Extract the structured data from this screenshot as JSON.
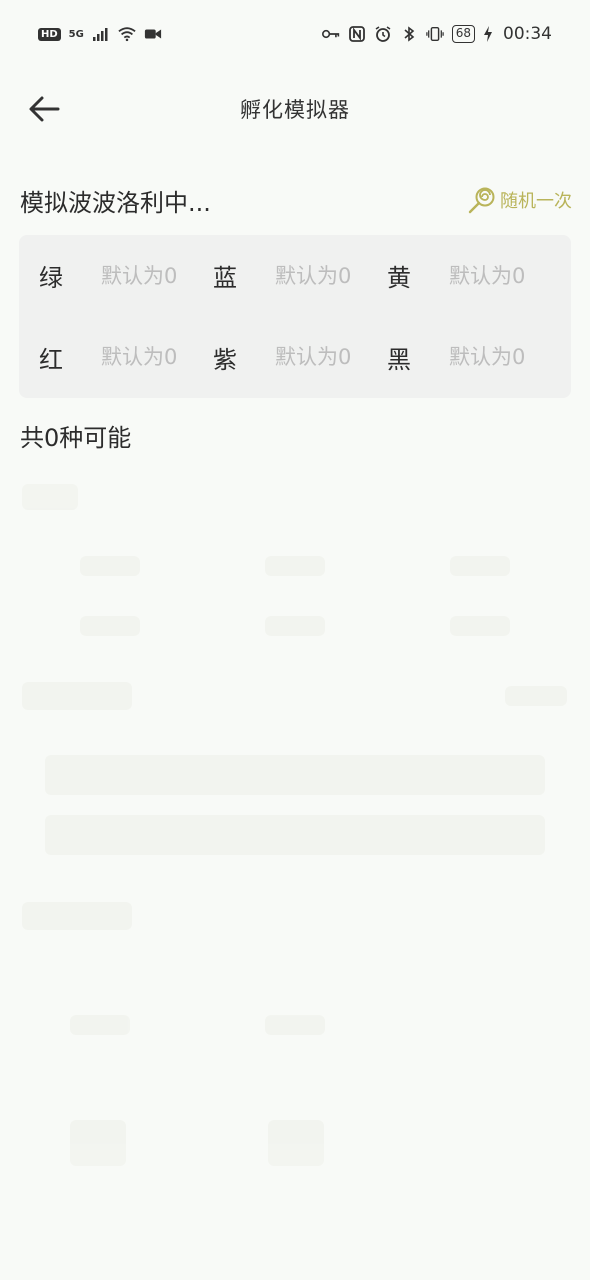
{
  "status_bar": {
    "left_badge": "HD",
    "network": "5G",
    "time": "00:34",
    "battery": "68"
  },
  "header": {
    "title": "孵化模拟器"
  },
  "simulator": {
    "title": "模拟波波洛利中...",
    "random_label": "随机一次",
    "accent_color": "#b9b45a"
  },
  "colors": [
    {
      "label": "绿",
      "placeholder": "默认为0"
    },
    {
      "label": "蓝",
      "placeholder": "默认为0"
    },
    {
      "label": "黄",
      "placeholder": "默认为0"
    },
    {
      "label": "红",
      "placeholder": "默认为0"
    },
    {
      "label": "紫",
      "placeholder": "默认为0"
    },
    {
      "label": "黑",
      "placeholder": "默认为0"
    }
  ],
  "result": {
    "count_text": "共0种可能"
  }
}
